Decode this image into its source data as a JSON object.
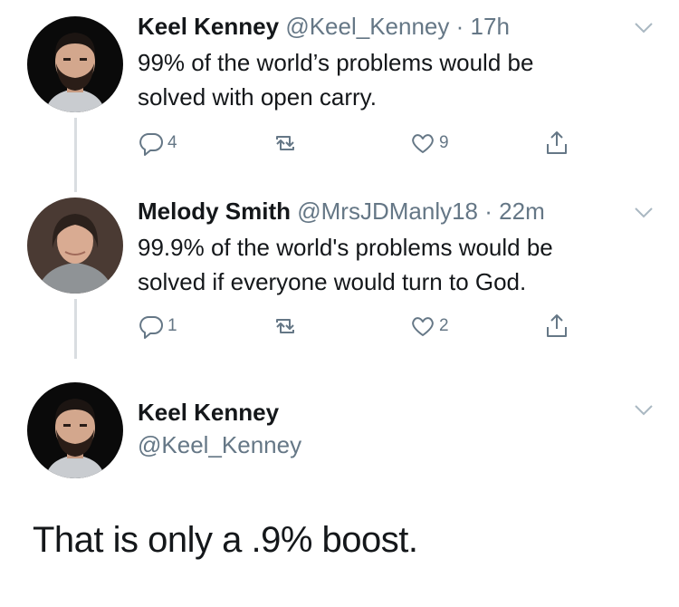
{
  "tweets": [
    {
      "name": "Keel Kenney",
      "handle": "@Keel_Kenney",
      "separator": "·",
      "time": "17h",
      "text_lines": [
        "99% of the world’s problems would be",
        "solved with open carry."
      ],
      "actions": {
        "reply_count": "4",
        "retweet_count": "",
        "like_count": "9"
      },
      "avatar": "bearded-man-avatar"
    },
    {
      "name": "Melody Smith",
      "handle": "@MrsJDManly18",
      "separator": "·",
      "time": "22m",
      "text_lines": [
        "99.9% of the world's problems would be",
        "solved if everyone would turn to God."
      ],
      "actions": {
        "reply_count": "1",
        "retweet_count": "",
        "like_count": "2"
      },
      "avatar": "woman-avatar"
    }
  ],
  "reply": {
    "name": "Keel Kenney",
    "handle": "@Keel_Kenney",
    "text": "That is only a .9% boost.",
    "avatar": "bearded-man-avatar"
  },
  "colors": {
    "text": "#14171a",
    "secondary": "#657786",
    "line": "#d9dde1"
  },
  "icons": [
    "reply-icon",
    "retweet-icon",
    "like-icon",
    "share-icon",
    "chevron-down-icon"
  ]
}
